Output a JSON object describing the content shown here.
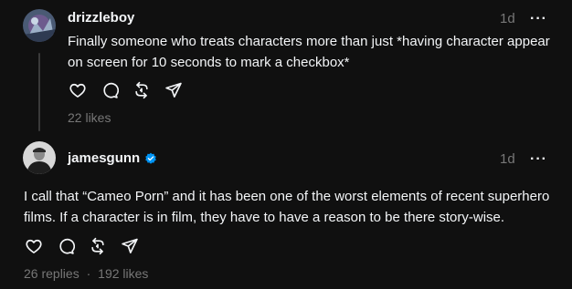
{
  "comment1": {
    "username": "drizzleboy",
    "time": "1d",
    "text_line1": "Finally someone who treats characters more than just *having character appear",
    "text_line2": "on screen for 10 seconds to mark a checkbox*",
    "likes": "22 likes"
  },
  "comment2": {
    "username": "jamesgunn",
    "time": "1d",
    "text_line1": "I call that “Cameo Porn” and it has been one of the worst elements of recent superhero",
    "text_line2": "films. If a character is in film, they have to have a reason to be there story-wise.",
    "replies": "26 replies",
    "separator": "·",
    "likes": "192 likes"
  },
  "more_label": "···",
  "colors": {
    "background": "#101010",
    "text": "#f3f5f7",
    "secondary": "#777777",
    "verified": "#0095f6",
    "thread_line": "#3a3a3a"
  },
  "icons": [
    "heart-icon",
    "comment-icon",
    "repost-icon",
    "share-icon",
    "verified-icon",
    "more-icon"
  ]
}
